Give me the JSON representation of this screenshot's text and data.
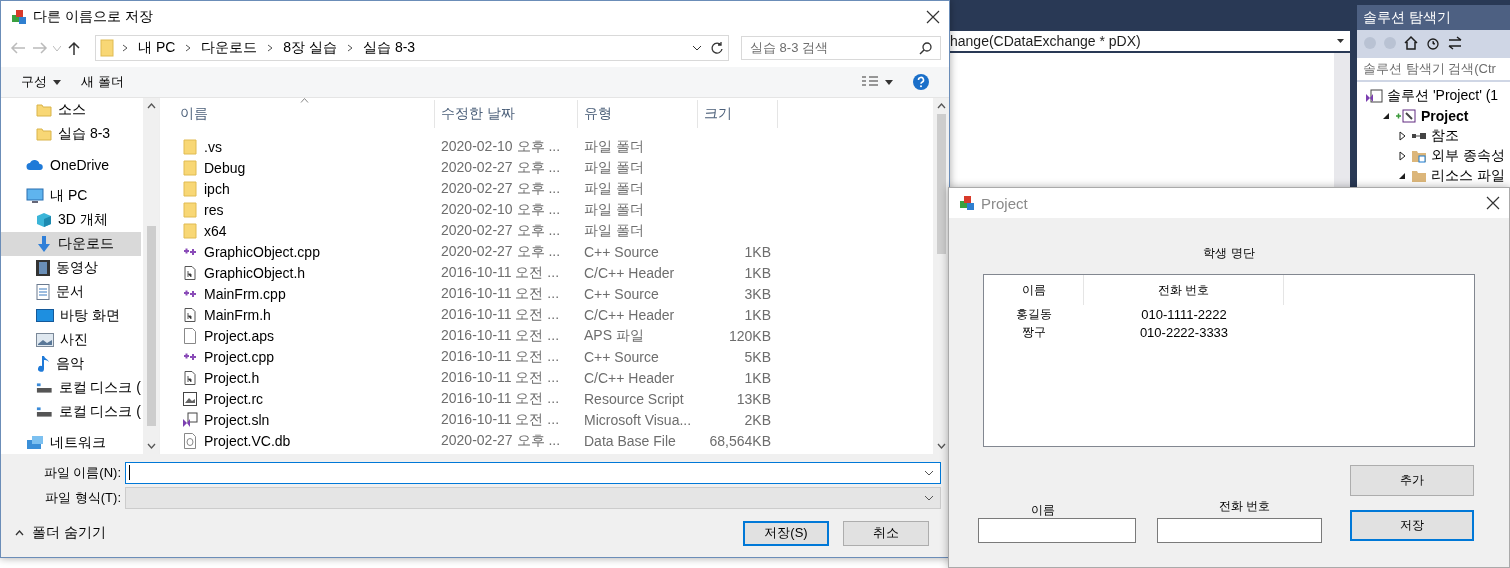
{
  "ide": {
    "member_combo": "hange(CDataExchange * pDX)",
    "solution_explorer": {
      "title": "솔루션 탐색기",
      "search_placeholder": "솔루션 탐색기 검색(Ctr",
      "tree": [
        {
          "label": "솔루션 'Project' (1",
          "kind": "solution",
          "children": [
            {
              "label": "Project",
              "kind": "project",
              "expanded": true,
              "children": [
                {
                  "label": "참조",
                  "kind": "references",
                  "expanded": false
                },
                {
                  "label": "외부 종속성",
                  "kind": "deps",
                  "expanded": false
                },
                {
                  "label": "리소스 파일",
                  "kind": "filter",
                  "expanded": true
                }
              ]
            }
          ]
        }
      ]
    }
  },
  "save_dialog": {
    "title": "다른 이름으로 저장",
    "path": [
      "내 PC",
      "다운로드",
      "8장 실습",
      "실습 8-3"
    ],
    "search_placeholder": "실습 8-3 검색",
    "toolbar": [
      {
        "label": "구성",
        "kind": "menu"
      },
      {
        "label": "새 폴더",
        "kind": "button"
      }
    ],
    "nav": [
      {
        "label": "소스",
        "kind": "folder",
        "selected": false
      },
      {
        "label": "실습 8-3",
        "kind": "folder",
        "selected": false
      },
      {
        "label": "OneDrive",
        "kind": "cloud",
        "selected": false
      },
      {
        "label": "내 PC",
        "kind": "pc",
        "selected": false,
        "children": [
          {
            "label": "3D 개체",
            "kind": "cube",
            "selected": false
          },
          {
            "label": "다운로드",
            "kind": "download",
            "selected": true
          },
          {
            "label": "동영상",
            "kind": "video",
            "selected": false
          },
          {
            "label": "문서",
            "kind": "document",
            "selected": false
          },
          {
            "label": "바탕 화면",
            "kind": "desktop",
            "selected": false
          },
          {
            "label": "사진",
            "kind": "image",
            "selected": false
          },
          {
            "label": "음악",
            "kind": "music",
            "selected": false
          },
          {
            "label": "로컬 디스크 (",
            "kind": "disk",
            "selected": false
          },
          {
            "label": "로컬 디스크 (",
            "kind": "disk",
            "selected": false
          }
        ]
      },
      {
        "label": "네트워크",
        "kind": "network",
        "selected": false
      }
    ],
    "columns": [
      {
        "label": "이름",
        "sorted": true
      },
      {
        "label": "수정한 날짜",
        "sorted": false
      },
      {
        "label": "유형",
        "sorted": false
      },
      {
        "label": "크기",
        "sorted": false
      }
    ],
    "files": [
      {
        "name": ".vs",
        "kind": "folder",
        "date": "2020-02-10 오후 ...",
        "type": "파일 폴더"
      },
      {
        "name": "Debug",
        "kind": "folder",
        "date": "2020-02-27 오후 ...",
        "type": "파일 폴더"
      },
      {
        "name": "ipch",
        "kind": "folder",
        "date": "2020-02-27 오후 ...",
        "type": "파일 폴더"
      },
      {
        "name": "res",
        "kind": "folder",
        "date": "2020-02-10 오후 ...",
        "type": "파일 폴더"
      },
      {
        "name": "x64",
        "kind": "folder",
        "date": "2020-02-27 오후 ...",
        "type": "파일 폴더"
      },
      {
        "name": "GraphicObject.cpp",
        "kind": "cpp",
        "date": "2020-02-27 오후 ...",
        "type": "C++ Source",
        "size": "1KB"
      },
      {
        "name": "GraphicObject.h",
        "kind": "header",
        "date": "2016-10-11 오전 ...",
        "type": "C/C++ Header",
        "size": "1KB"
      },
      {
        "name": "MainFrm.cpp",
        "kind": "cpp",
        "date": "2016-10-11 오전 ...",
        "type": "C++ Source",
        "size": "3KB"
      },
      {
        "name": "MainFrm.h",
        "kind": "header",
        "date": "2016-10-11 오전 ...",
        "type": "C/C++ Header",
        "size": "1KB"
      },
      {
        "name": "Project.aps",
        "kind": "blank",
        "date": "2016-10-11 오전 ...",
        "type": "APS 파일",
        "size": "120KB"
      },
      {
        "name": "Project.cpp",
        "kind": "cpp",
        "date": "2016-10-11 오전 ...",
        "type": "C++ Source",
        "size": "5KB"
      },
      {
        "name": "Project.h",
        "kind": "header",
        "date": "2016-10-11 오전 ...",
        "type": "C/C++ Header",
        "size": "1KB"
      },
      {
        "name": "Project.rc",
        "kind": "resource",
        "date": "2016-10-11 오전 ...",
        "type": "Resource Script",
        "size": "13KB"
      },
      {
        "name": "Project.sln",
        "kind": "solution",
        "date": "2016-10-11 오전 ...",
        "type": "Microsoft Visua...",
        "size": "2KB"
      },
      {
        "name": "Project.VC.db",
        "kind": "database",
        "date": "2020-02-27 오후 ...",
        "type": "Data Base File",
        "size": "68,564KB"
      }
    ],
    "filename": {
      "label": "파일 이름(N):",
      "focused": true
    },
    "filetype": {
      "label": "파일 형식(T):",
      "disabled": true
    },
    "hide_folders": "폴더 숨기기",
    "buttons": [
      {
        "label": "저장(S)",
        "default": true
      },
      {
        "label": "취소",
        "default": false
      }
    ]
  },
  "project_dialog": {
    "title": "Project",
    "heading": "학생 명단",
    "columns": [
      "이름",
      "전화 번호"
    ],
    "rows": [
      [
        "홍길동",
        "010-1111-2222"
      ],
      [
        "짱구",
        "010-2222-3333"
      ]
    ],
    "fields": [
      {
        "label": "이름"
      },
      {
        "label": "전화 번호"
      }
    ],
    "buttons": [
      {
        "label": "추가",
        "focused": false
      },
      {
        "label": "저장",
        "focused": true
      }
    ]
  }
}
